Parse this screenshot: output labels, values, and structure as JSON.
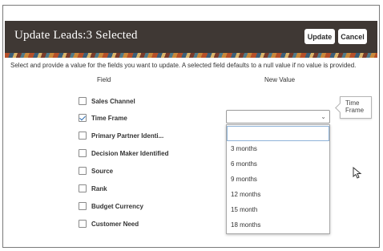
{
  "dialog": {
    "title": "Update Leads:3 Selected",
    "update_label": "Update",
    "cancel_label": "Cancel",
    "instruction": "Select and provide a value for the fields you want to update. A selected field defaults to a null value if no value is provided.",
    "column_field": "Field",
    "column_new_value": "New Value"
  },
  "fields": [
    {
      "label": "Sales Channel",
      "checked": false
    },
    {
      "label": "Time Frame",
      "checked": true
    },
    {
      "label": "Primary Partner Identi...",
      "checked": false
    },
    {
      "label": "Decision Maker Identified",
      "checked": false
    },
    {
      "label": "Source",
      "checked": false
    },
    {
      "label": "Rank",
      "checked": false
    },
    {
      "label": "Budget Currency",
      "checked": false
    },
    {
      "label": "Customer Need",
      "checked": false
    }
  ],
  "time_frame": {
    "selected_value": "",
    "options": [
      "",
      "3 months",
      "6 months",
      "9 months",
      "12 months",
      "15 month",
      "18 months"
    ],
    "tooltip": "Time Frame"
  },
  "colors": {
    "header_bg": "#3f3834",
    "check_accent": "#2f6fb2"
  }
}
